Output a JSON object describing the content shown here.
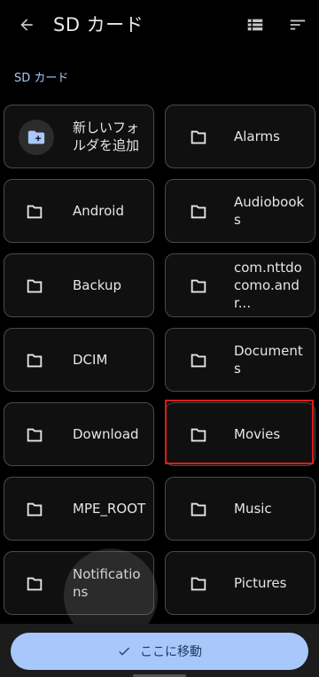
{
  "header": {
    "title": "SD カード"
  },
  "breadcrumb": {
    "label": "SD カード"
  },
  "new_folder": {
    "label": "新しいフォルダを追加"
  },
  "folders": [
    "Alarms",
    "Android",
    "Audiobooks",
    "Backup",
    "com.nttdocomo.andr...",
    "DCIM",
    "Documents",
    "Download",
    "Movies",
    "MPE_ROOT",
    "Music",
    "Notifications",
    "Pictures"
  ],
  "bottom": {
    "move_label": "ここに移動"
  },
  "colors": {
    "accent": "#a8c7fa",
    "highlight": "#e0191a",
    "tile_border": "#4a4a4a"
  }
}
